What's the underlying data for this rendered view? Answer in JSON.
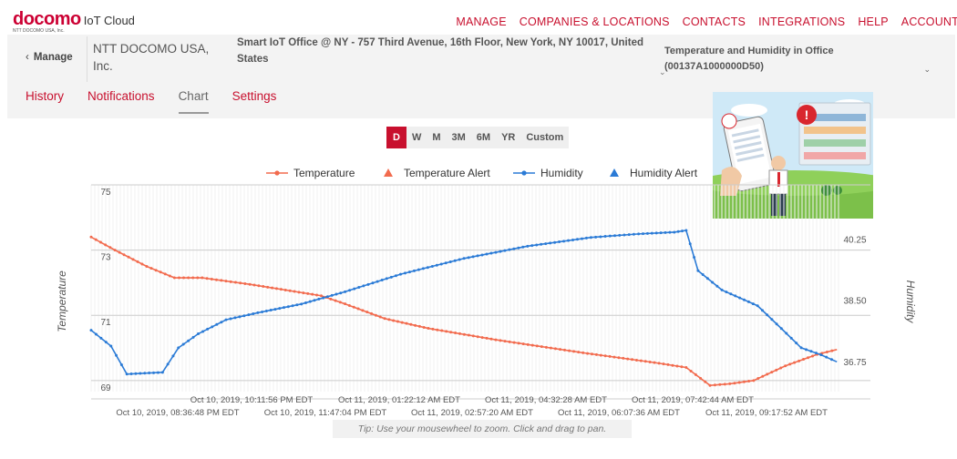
{
  "header": {
    "brand": "docomo",
    "product": "IoT Cloud",
    "subtitle": "NTT DOCOMO USA, Inc.",
    "nav": [
      "MANAGE",
      "COMPANIES & LOCATIONS",
      "CONTACTS",
      "INTEGRATIONS",
      "HELP",
      "ACCOUNT"
    ]
  },
  "context": {
    "manage_label": "Manage",
    "company": "NTT DOCOMO USA, Inc.",
    "address": "Smart IoT Office @ NY - 757 Third Avenue, 16th Floor, New York, NY 10017, United States",
    "device_line1": "Temperature and Humidity in Office",
    "device_line2": "(00137A1000000D50)"
  },
  "tabs": [
    {
      "label": "History",
      "active": false
    },
    {
      "label": "Notifications",
      "active": false
    },
    {
      "label": "Chart",
      "active": true
    },
    {
      "label": "Settings",
      "active": false
    }
  ],
  "range_buttons": [
    {
      "label": "D",
      "active": true
    },
    {
      "label": "W",
      "active": false
    },
    {
      "label": "M",
      "active": false
    },
    {
      "label": "3M",
      "active": false
    },
    {
      "label": "6M",
      "active": false
    },
    {
      "label": "YR",
      "active": false
    },
    {
      "label": "Custom",
      "active": false
    }
  ],
  "tip": "Tip: Use your mousewheel to zoom. Click and drag to pan.",
  "colors": {
    "accent": "#c8102e",
    "temperature": "#f26b4e",
    "humidity": "#2b7bd6"
  },
  "chart_data": {
    "type": "line",
    "y_left_label": "Temperature",
    "y_right_label": "Humidity",
    "y_left_ticks": [
      "75",
      "73",
      "71",
      "69"
    ],
    "y_right_ticks": [
      "40.25",
      "38.50",
      "36.75"
    ],
    "ylim_left": [
      68.66,
      75.0
    ],
    "ylim_right": [
      36.1,
      42.0
    ],
    "legend": [
      {
        "label": "Temperature",
        "kind": "line"
      },
      {
        "label": "Temperature Alert",
        "kind": "triangle"
      },
      {
        "label": "Humidity",
        "kind": "line"
      },
      {
        "label": "Humidity Alert",
        "kind": "triangle"
      }
    ],
    "x_ticks_upper": [
      "Oct 10, 2019, 10:11:56 PM EDT",
      "Oct 11, 2019, 01:22:12 AM EDT",
      "Oct 11, 2019, 04:32:28 AM EDT",
      "Oct 11, 2019, 07:42:44 AM EDT"
    ],
    "x_ticks_lower": [
      "Oct 10, 2019, 08:36:48 PM EDT",
      "Oct 10, 2019, 11:47:04 PM EDT",
      "Oct 11, 2019, 02:57:20 AM EDT",
      "Oct 11, 2019, 06:07:36 AM EDT",
      "Oct 11, 2019, 09:17:52 AM EDT"
    ],
    "series": [
      {
        "name": "Temperature",
        "points": [
          [
            "Oct 10, 2019, 07:10 PM",
            73.4
          ],
          [
            "Oct 10, 2019, 07:40 PM",
            73.0
          ],
          [
            "Oct 10, 2019, 08:20 PM",
            72.5
          ],
          [
            "Oct 10, 2019, 08:55 PM",
            72.15
          ],
          [
            "Oct 10, 2019, 09:30 PM",
            72.15
          ],
          [
            "Oct 10, 2019, 10:30 PM",
            71.95
          ],
          [
            "Oct 11, 2019, 12:00 AM",
            71.6
          ],
          [
            "Oct 11, 2019, 12:30 AM",
            71.35
          ],
          [
            "Oct 11, 2019, 01:20 AM",
            70.9
          ],
          [
            "Oct 11, 2019, 02:15 AM",
            70.6
          ],
          [
            "Oct 11, 2019, 03:40 AM",
            70.25
          ],
          [
            "Oct 11, 2019, 05:30 AM",
            69.85
          ],
          [
            "Oct 11, 2019, 07:00 AM",
            69.55
          ],
          [
            "Oct 11, 2019, 07:40 AM",
            69.4
          ],
          [
            "Oct 11, 2019, 08:10 AM",
            68.85
          ],
          [
            "Oct 11, 2019, 08:35 AM",
            68.9
          ],
          [
            "Oct 11, 2019, 09:05 AM",
            69.0
          ],
          [
            "Oct 11, 2019, 09:45 AM",
            69.45
          ],
          [
            "Oct 11, 2019, 10:25 AM",
            69.8
          ],
          [
            "Oct 11, 2019, 10:50 AM",
            69.95
          ]
        ]
      },
      {
        "name": "Humidity",
        "points": [
          [
            "Oct 10, 2019, 07:10 PM",
            37.85
          ],
          [
            "Oct 10, 2019, 07:35 PM",
            37.4
          ],
          [
            "Oct 10, 2019, 07:55 PM",
            36.6
          ],
          [
            "Oct 10, 2019, 08:40 PM",
            36.65
          ],
          [
            "Oct 10, 2019, 09:00 PM",
            37.35
          ],
          [
            "Oct 10, 2019, 09:25 PM",
            37.75
          ],
          [
            "Oct 10, 2019, 10:00 PM",
            38.15
          ],
          [
            "Oct 10, 2019, 10:40 PM",
            38.35
          ],
          [
            "Oct 10, 2019, 11:35 PM",
            38.6
          ],
          [
            "Oct 11, 2019, 12:30 AM",
            38.95
          ],
          [
            "Oct 11, 2019, 01:40 AM",
            39.45
          ],
          [
            "Oct 11, 2019, 03:00 AM",
            39.9
          ],
          [
            "Oct 11, 2019, 04:20 AM",
            40.25
          ],
          [
            "Oct 11, 2019, 05:40 AM",
            40.5
          ],
          [
            "Oct 11, 2019, 06:40 AM",
            40.6
          ],
          [
            "Oct 11, 2019, 07:25 AM",
            40.65
          ],
          [
            "Oct 11, 2019, 07:40 AM",
            40.7
          ],
          [
            "Oct 11, 2019, 07:55 AM",
            39.55
          ],
          [
            "Oct 11, 2019, 08:25 AM",
            39.0
          ],
          [
            "Oct 11, 2019, 09:10 AM",
            38.55
          ],
          [
            "Oct 11, 2019, 09:40 AM",
            37.9
          ],
          [
            "Oct 11, 2019, 10:05 AM",
            37.35
          ],
          [
            "Oct 11, 2019, 10:30 AM",
            37.15
          ],
          [
            "Oct 11, 2019, 10:50 AM",
            36.95
          ]
        ]
      }
    ]
  }
}
